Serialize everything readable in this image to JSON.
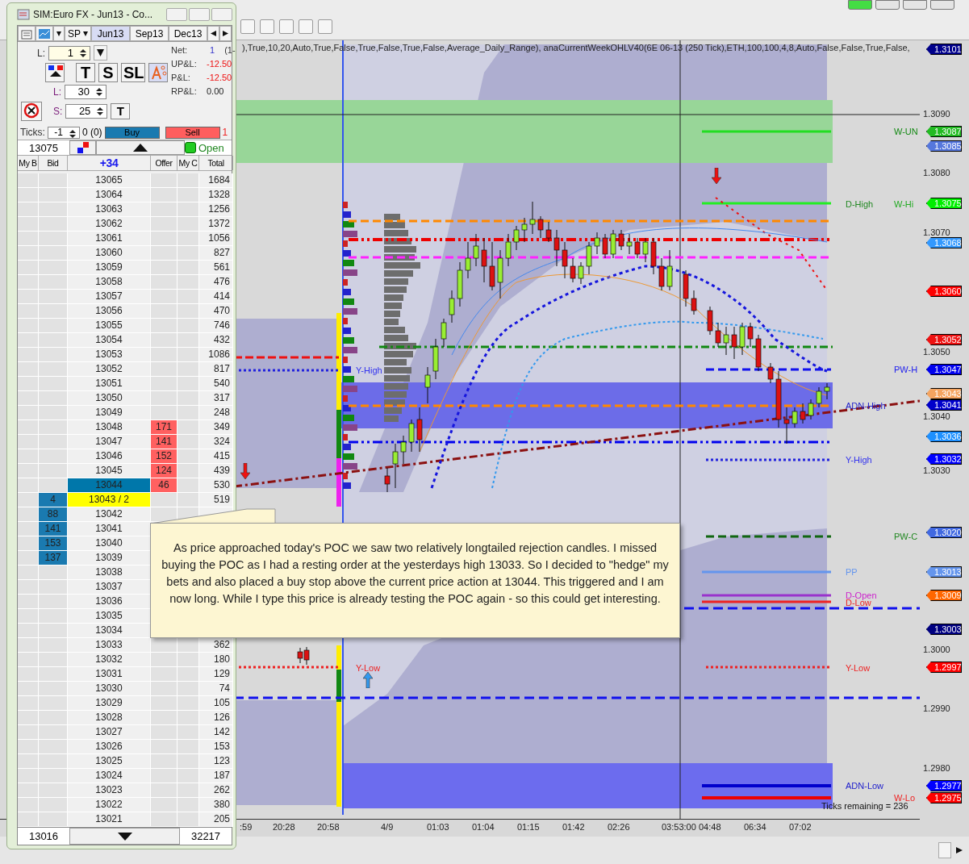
{
  "chart": {
    "indicator_text": "),True,10,20,Auto,True,False,True,False,True,False,Average_Daily_Range), anaCurrentWeekOHLV40(6E 06-13 (250 Tick),ETH,100,100,4,8,Auto,False,False,True,False,",
    "price_ticks": [
      "1.3090",
      "1.3080",
      "1.3070",
      "1.3050",
      "1.3040",
      "1.3030",
      "1.3000",
      "1.2990",
      "1.2980"
    ],
    "price_tags": [
      {
        "text": "1.3101",
        "color": "#00008b"
      },
      {
        "text": "1.3087",
        "color": "#22bb22"
      },
      {
        "text": "1.3085",
        "color": "#5577dd"
      },
      {
        "text": "1.3075",
        "color": "#00ee00"
      },
      {
        "text": "1.3068",
        "color": "#3399ff"
      },
      {
        "text": "1.3060",
        "color": "#ff0000"
      },
      {
        "text": "1.3052",
        "color": "#ee1111"
      },
      {
        "text": "1.3047",
        "color": "#0000ee"
      },
      {
        "text": "1.3043",
        "color": "#f4a460"
      },
      {
        "text": "1.3041",
        "color": "#0000cc"
      },
      {
        "text": "1.3036",
        "color": "#1e90ff"
      },
      {
        "text": "1.3032",
        "color": "#0000ff"
      },
      {
        "text": "1.3020",
        "color": "#4169e1"
      },
      {
        "text": "1.3013",
        "color": "#6495ed"
      },
      {
        "text": "1.3009",
        "color": "#ff6600"
      },
      {
        "text": "1.3003",
        "color": "#000080"
      },
      {
        "text": "1.2997",
        "color": "#ff0000"
      },
      {
        "text": "1.2977",
        "color": "#0000ff"
      },
      {
        "text": "1.2975",
        "color": "#ff0000"
      }
    ],
    "level_labels": [
      {
        "text": "W-UN",
        "color": "#118811"
      },
      {
        "text": "D-High",
        "color": "#228822"
      },
      {
        "text": "W-Hi",
        "color": "#22aa22"
      },
      {
        "text": "PW-H",
        "color": "#2222ee"
      },
      {
        "text": "ADN-High",
        "color": "#2222cc"
      },
      {
        "text": "Y-High",
        "color": "#3333ee"
      },
      {
        "text": "PW-C",
        "color": "#228822"
      },
      {
        "text": "PP",
        "color": "#6495ed"
      },
      {
        "text": "D-Open",
        "color": "#cc22cc"
      },
      {
        "text": "D-Low",
        "color": "#ee2222"
      },
      {
        "text": "Y-Low",
        "color": "#ee2222"
      },
      {
        "text": "ADN-Low",
        "color": "#2222cc"
      },
      {
        "text": "W-Lo",
        "color": "#ee2222"
      },
      {
        "text": "Y-High",
        "color": "#3333ee"
      },
      {
        "text": "Y-Low",
        "color": "#ee2222"
      }
    ],
    "ticks_remaining": "Ticks remaining = 236",
    "time_labels": [
      ":59",
      "20:28",
      "20:58",
      "4/9",
      "01:03",
      "01:04",
      "01:15",
      "01:42",
      "02:26",
      "03:53:00",
      "04:48",
      "06:34",
      "07:02"
    ],
    "note": "As price approached today's POC we saw two relatively longtailed rejection candles. I missed buying the POC as I had a resting order at the yesterdays high 13033.  So I decided to \"hedge\" my bets and also placed a buy stop above the current price action at 13044.  This triggered and I am now long. While I type this price is already testing the POC again - so this could get interesting."
  },
  "dom": {
    "title": "SIM:Euro FX - Jun13 - Co...",
    "account": "SP",
    "tabs": [
      {
        "label": "Jun13",
        "selected": true
      },
      {
        "label": "Sep13",
        "selected": false
      },
      {
        "label": "Dec13",
        "selected": false
      }
    ],
    "qty_label": "L:",
    "qty": "1",
    "order_buttons": [
      "T",
      "S",
      "SL"
    ],
    "stop_rows": [
      {
        "label": "L:",
        "value": "30"
      },
      {
        "label": "S:",
        "value": "25"
      }
    ],
    "stop_button": "T",
    "stats": [
      {
        "label": "Net:",
        "value": "1",
        "kind": "net"
      },
      {
        "label": "UP&L:",
        "value": "-12.50",
        "kind": "loss"
      },
      {
        "label": "P&L:",
        "value": "-12.50",
        "kind": "loss"
      },
      {
        "label": "RP&L:",
        "value": "0.00",
        "kind": "plain"
      }
    ],
    "net_extra": "(1-",
    "ticks_label": "Ticks:",
    "ticks": "-1",
    "ticks_info": "0 (0)",
    "buy": "Buy",
    "sell": "Sell",
    "sell_extra": "1",
    "last_price": "13075",
    "status": {
      "label": "Open",
      "connected": true
    },
    "headers": [
      "My B",
      "Bid",
      "+34",
      "Offer",
      "My C",
      "Total"
    ],
    "rows": [
      {
        "price": "13065",
        "bid": "",
        "offer": "",
        "total": "1684",
        "kind": "plain"
      },
      {
        "price": "13064",
        "bid": "",
        "offer": "",
        "total": "1328",
        "kind": "plain"
      },
      {
        "price": "13063",
        "bid": "",
        "offer": "",
        "total": "1256",
        "kind": "plain"
      },
      {
        "price": "13062",
        "bid": "",
        "offer": "",
        "total": "1372",
        "kind": "plain"
      },
      {
        "price": "13061",
        "bid": "",
        "offer": "",
        "total": "1056",
        "kind": "plain"
      },
      {
        "price": "13060",
        "bid": "",
        "offer": "",
        "total": "827",
        "kind": "plain"
      },
      {
        "price": "13059",
        "bid": "",
        "offer": "",
        "total": "561",
        "kind": "plain"
      },
      {
        "price": "13058",
        "bid": "",
        "offer": "",
        "total": "476",
        "kind": "plain"
      },
      {
        "price": "13057",
        "bid": "",
        "offer": "",
        "total": "414",
        "kind": "plain"
      },
      {
        "price": "13056",
        "bid": "",
        "offer": "",
        "total": "470",
        "kind": "plain"
      },
      {
        "price": "13055",
        "bid": "",
        "offer": "",
        "total": "746",
        "kind": "plain"
      },
      {
        "price": "13054",
        "bid": "",
        "offer": "",
        "total": "432",
        "kind": "plain"
      },
      {
        "price": "13053",
        "bid": "",
        "offer": "",
        "total": "1086",
        "kind": "plain"
      },
      {
        "price": "13052",
        "bid": "",
        "offer": "",
        "total": "817",
        "kind": "plain"
      },
      {
        "price": "13051",
        "bid": "",
        "offer": "",
        "total": "540",
        "kind": "plain"
      },
      {
        "price": "13050",
        "bid": "",
        "offer": "",
        "total": "317",
        "kind": "plain"
      },
      {
        "price": "13049",
        "bid": "",
        "offer": "",
        "total": "248",
        "kind": "plain"
      },
      {
        "price": "13048",
        "bid": "",
        "offer": "171",
        "total": "349",
        "kind": "plain"
      },
      {
        "price": "13047",
        "bid": "",
        "offer": "141",
        "total": "324",
        "kind": "plain"
      },
      {
        "price": "13046",
        "bid": "",
        "offer": "152",
        "total": "415",
        "kind": "plain"
      },
      {
        "price": "13045",
        "bid": "",
        "offer": "124",
        "total": "439",
        "kind": "plain"
      },
      {
        "price": "13044",
        "bid": "",
        "offer": "46",
        "total": "530",
        "kind": "last"
      },
      {
        "price": "13043 / 2",
        "bid": "4",
        "offer": "",
        "total": "519",
        "kind": "current"
      },
      {
        "price": "13042",
        "bid": "88",
        "offer": "",
        "total": "",
        "kind": "plain"
      },
      {
        "price": "13041",
        "bid": "141",
        "offer": "",
        "total": "",
        "kind": "plain"
      },
      {
        "price": "13040",
        "bid": "153",
        "offer": "",
        "total": "",
        "kind": "plain"
      },
      {
        "price": "13039",
        "bid": "137",
        "offer": "",
        "total": "",
        "kind": "plain"
      },
      {
        "price": "13038",
        "bid": "",
        "offer": "",
        "total": "",
        "kind": "plain"
      },
      {
        "price": "13037",
        "bid": "",
        "offer": "",
        "total": "",
        "kind": "plain"
      },
      {
        "price": "13036",
        "bid": "",
        "offer": "",
        "total": "",
        "kind": "plain"
      },
      {
        "price": "13035",
        "bid": "",
        "offer": "",
        "total": "",
        "kind": "plain"
      },
      {
        "price": "13034",
        "bid": "",
        "offer": "",
        "total": "",
        "kind": "plain"
      },
      {
        "price": "13033",
        "bid": "",
        "offer": "",
        "total": "362",
        "kind": "plain"
      },
      {
        "price": "13032",
        "bid": "",
        "offer": "",
        "total": "180",
        "kind": "plain"
      },
      {
        "price": "13031",
        "bid": "",
        "offer": "",
        "total": "129",
        "kind": "plain"
      },
      {
        "price": "13030",
        "bid": "",
        "offer": "",
        "total": "74",
        "kind": "plain"
      },
      {
        "price": "13029",
        "bid": "",
        "offer": "",
        "total": "105",
        "kind": "plain"
      },
      {
        "price": "13028",
        "bid": "",
        "offer": "",
        "total": "126",
        "kind": "plain"
      },
      {
        "price": "13027",
        "bid": "",
        "offer": "",
        "total": "142",
        "kind": "plain"
      },
      {
        "price": "13026",
        "bid": "",
        "offer": "",
        "total": "153",
        "kind": "plain"
      },
      {
        "price": "13025",
        "bid": "",
        "offer": "",
        "total": "123",
        "kind": "plain"
      },
      {
        "price": "13024",
        "bid": "",
        "offer": "",
        "total": "187",
        "kind": "plain"
      },
      {
        "price": "13023",
        "bid": "",
        "offer": "",
        "total": "262",
        "kind": "plain"
      },
      {
        "price": "13022",
        "bid": "",
        "offer": "",
        "total": "380",
        "kind": "plain"
      },
      {
        "price": "13021",
        "bid": "",
        "offer": "",
        "total": "205",
        "kind": "plain"
      }
    ],
    "footer": {
      "low": "13016",
      "volume": "32217"
    }
  }
}
